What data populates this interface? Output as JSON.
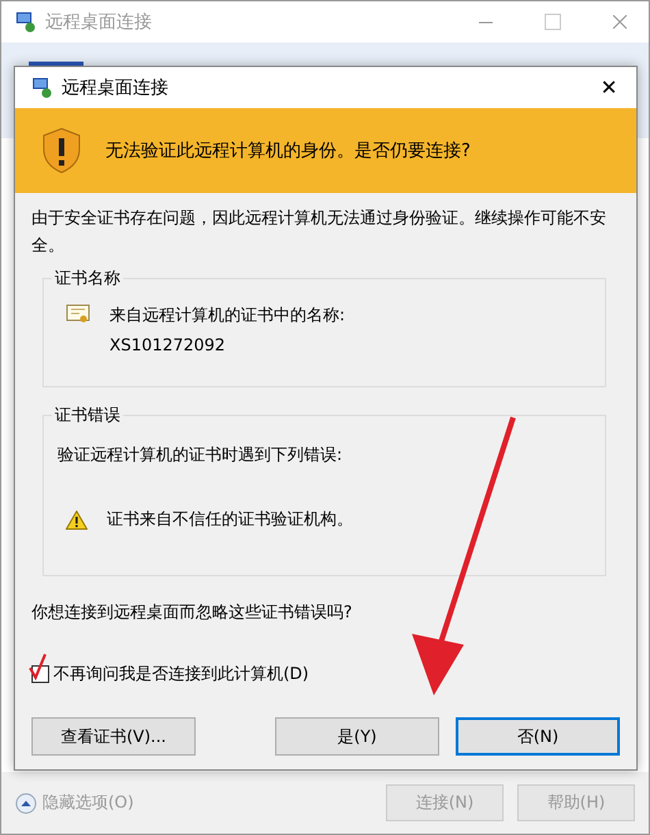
{
  "main_window": {
    "title": "远程桌面连接",
    "options_link": "隐藏选项(O)",
    "buttons": [
      {
        "label": "连接(N)",
        "disabled": true
      },
      {
        "label": "帮助(H)",
        "disabled": true
      }
    ]
  },
  "dialog": {
    "title": "远程桌面连接",
    "close": "✕",
    "warning": "无法验证此远程计算机的身份。是否仍要连接?",
    "description": "由于安全证书存在问题，因此远程计算机无法通过身份验证。继续操作可能不安全。",
    "cert_name_group": {
      "title": "证书名称",
      "label": "来自远程计算机的证书中的名称:",
      "value": "XS101272092"
    },
    "cert_error_group": {
      "title": "证书错误",
      "intro": "验证远程计算机的证书时遇到下列错误:",
      "errors": [
        "证书来自不信任的证书验证机构。"
      ]
    },
    "question": "你想连接到远程桌面而忽略这些证书错误吗?",
    "checkbox": {
      "label": "不再询问我是否连接到此计算机(D)",
      "checked": true
    },
    "buttons": [
      {
        "label": "查看证书(V)...",
        "default": false
      },
      {
        "label": "是(Y)",
        "default": false
      },
      {
        "label": "否(N)",
        "default": true
      }
    ]
  }
}
